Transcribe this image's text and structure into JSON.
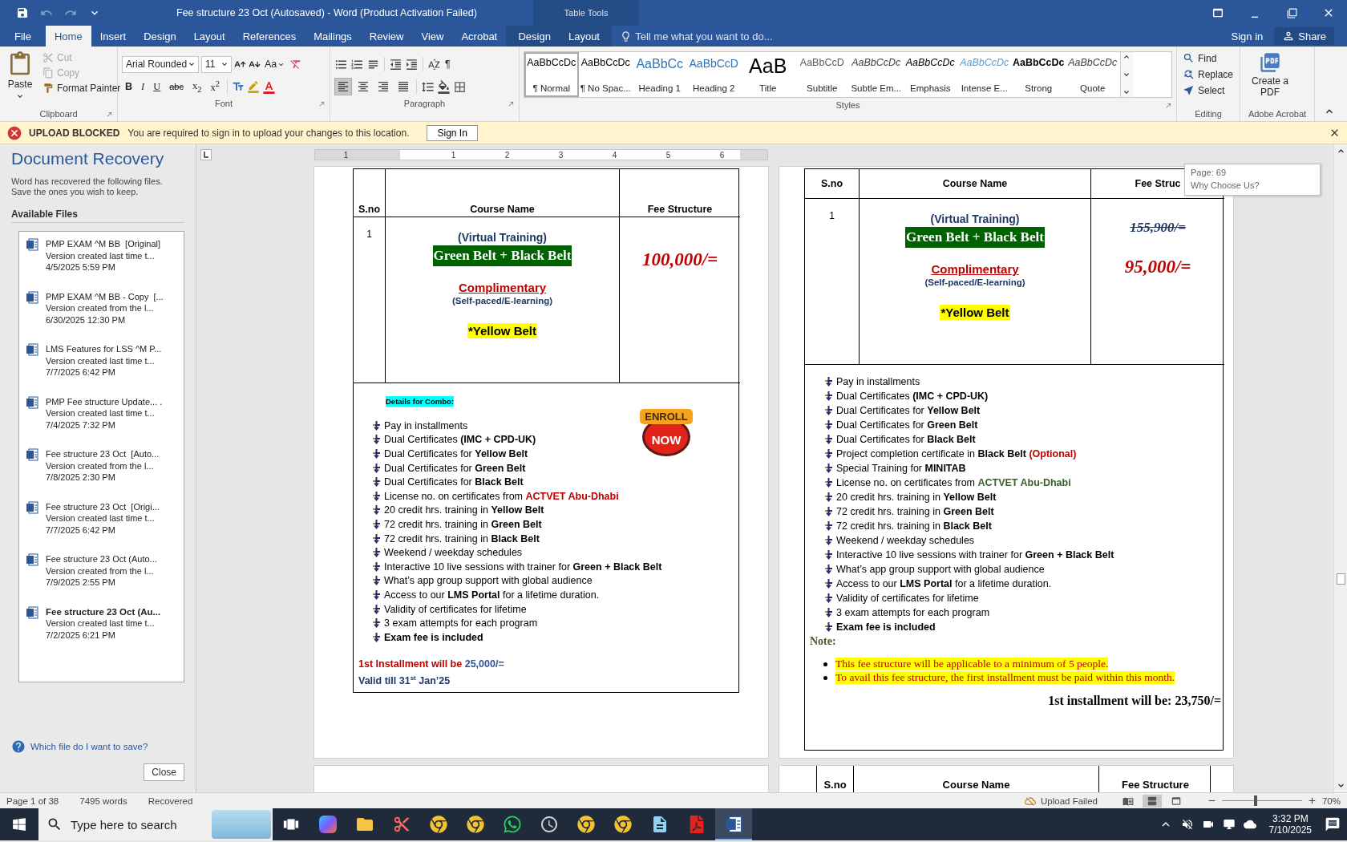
{
  "window": {
    "title": "Fee structure 23 Oct (Autosaved) - Word (Product Activation Failed)",
    "context_label": "Table Tools",
    "quick_access": [
      {
        "kind": "save",
        "disabled": false
      },
      {
        "kind": "undo",
        "disabled": true
      },
      {
        "kind": "redo",
        "disabled": true
      },
      {
        "kind": "customize",
        "disabled": false
      }
    ]
  },
  "menu": {
    "tabs": [
      {
        "label": "File",
        "kind": "file",
        "selected": false
      },
      {
        "label": "Home",
        "kind": "tab",
        "selected": true
      },
      {
        "label": "Insert",
        "kind": "tab",
        "selected": false
      },
      {
        "label": "Design",
        "kind": "tab",
        "selected": false
      },
      {
        "label": "Layout",
        "kind": "tab",
        "selected": false
      },
      {
        "label": "References",
        "kind": "tab",
        "selected": false
      },
      {
        "label": "Mailings",
        "kind": "tab",
        "selected": false
      },
      {
        "label": "Review",
        "kind": "tab",
        "selected": false
      },
      {
        "label": "View",
        "kind": "tab",
        "selected": false
      },
      {
        "label": "Acrobat",
        "kind": "tab",
        "selected": false
      },
      {
        "label": "Design",
        "kind": "context",
        "selected": false
      },
      {
        "label": "Layout",
        "kind": "context",
        "selected": false
      }
    ],
    "tell_me": "Tell me what you want to do...",
    "sign_in": "Sign in",
    "share": "Share"
  },
  "ribbon": {
    "clipboard": {
      "label": "Clipboard",
      "paste": "Paste",
      "items": [
        {
          "label": "Cut",
          "kind": "cut",
          "disabled": true
        },
        {
          "label": "Copy",
          "kind": "copy",
          "disabled": true
        },
        {
          "label": "Format Painter",
          "kind": "painter",
          "disabled": false
        }
      ]
    },
    "font": {
      "label": "Font",
      "name": "Arial Rounded",
      "size": "11",
      "case_button": "Aa",
      "format_buttons": [
        {
          "label": "B",
          "kind": "bold"
        },
        {
          "label": "I",
          "kind": "italic"
        },
        {
          "label": "U",
          "kind": "underline"
        },
        {
          "label": "abc",
          "kind": "strike"
        },
        {
          "label": "x$_{2}$",
          "kind": "sub"
        },
        {
          "label": "x$^{2}$",
          "kind": "sup"
        }
      ]
    },
    "paragraph": {
      "label": "Paragraph",
      "pilcrow": "¶",
      "align_buttons": [
        {
          "kind": "left",
          "selected": true
        },
        {
          "kind": "center",
          "selected": false
        },
        {
          "kind": "right",
          "selected": false
        },
        {
          "kind": "justify",
          "selected": false
        }
      ]
    },
    "styles": {
      "label": "Styles",
      "items": [
        {
          "preview": "AaBbCcDc",
          "name": "¶ Normal",
          "kind": "normal",
          "selected": true
        },
        {
          "preview": "AaBbCcDc",
          "name": "¶ No Spac...",
          "kind": "normal",
          "selected": false
        },
        {
          "preview": "AaBbCc",
          "name": "Heading 1",
          "kind": "heading1",
          "selected": false
        },
        {
          "preview": "AaBbCcD",
          "name": "Heading 2",
          "kind": "heading2",
          "selected": false
        },
        {
          "preview": "AaB",
          "name": "Title",
          "kind": "title",
          "selected": false
        },
        {
          "preview": "AaBbCcD",
          "name": "Subtitle",
          "kind": "subtitle",
          "selected": false
        },
        {
          "preview": "AaBbCcDc",
          "name": "Subtle Em...",
          "kind": "subtle",
          "selected": false
        },
        {
          "preview": "AaBbCcDc",
          "name": "Emphasis",
          "kind": "emphasis",
          "selected": false
        },
        {
          "preview": "AaBbCcDc",
          "name": "Intense E...",
          "kind": "intense",
          "selected": false
        },
        {
          "preview": "AaBbCcDc",
          "name": "Strong",
          "kind": "strong",
          "selected": false
        },
        {
          "preview": "AaBbCcDc",
          "name": "Quote",
          "kind": "quote",
          "selected": false
        }
      ]
    },
    "editing": {
      "label": "Editing",
      "items": [
        {
          "label": "Find",
          "kind": "find"
        },
        {
          "label": "Replace",
          "kind": "replace"
        },
        {
          "label": "Select",
          "kind": "select"
        }
      ]
    },
    "acrobat": {
      "label": "Adobe Acrobat",
      "button": "Create a PDF"
    }
  },
  "message_bar": {
    "title": "UPLOAD BLOCKED",
    "text": "You are required to sign in to upload your changes to this location.",
    "button": "Sign In"
  },
  "recovery": {
    "title": "Document Recovery",
    "description": "Word has recovered the following files. Save the ones you wish to keep.",
    "list_label": "Available Files",
    "files": [
      {
        "name": "PMP EXAM ^M BB  [Original]",
        "note": "Version created last time t...",
        "date": "4/5/2025 5:59 PM",
        "selected": false
      },
      {
        "name": "PMP EXAM ^M BB - Copy  [...",
        "note": "Version created from the l...",
        "date": "6/30/2025 12:30 PM",
        "selected": false
      },
      {
        "name": "LMS Features for LSS ^M P...",
        "note": "Version created last time t...",
        "date": "7/7/2025 6:42 PM",
        "selected": false
      },
      {
        "name": "PMP Fee structure Update... .",
        "note": "Version created last time t...",
        "date": "7/4/2025 7:32 PM",
        "selected": false
      },
      {
        "name": "Fee structure 23 Oct  [Auto...",
        "note": "Version created from the l...",
        "date": "7/8/2025 2:30 PM",
        "selected": false
      },
      {
        "name": "Fee structure 23 Oct  [Origi...",
        "note": "Version created last time t...",
        "date": "7/7/2025 6:42 PM",
        "selected": false
      },
      {
        "name": "Fee structure 23 Oct (Auto...",
        "note": "Version created from the l...",
        "date": "7/9/2025 2:55 PM",
        "selected": false
      },
      {
        "name": "Fee structure 23 Oct (Au...",
        "note": "Version created last time t...",
        "date": "7/2/2025 6:21 PM",
        "selected": true
      }
    ],
    "help": "Which file do I want to save?",
    "close": "Close"
  },
  "ruler": {
    "numbers": [
      "1",
      "1",
      "2",
      "3",
      "4",
      "5",
      "6"
    ]
  },
  "tooltip": {
    "page": "Page: 69",
    "heading": "Why Choose Us?"
  },
  "pages": [
    {
      "columns": [
        "S.no",
        "Course Name",
        "Fee Structure"
      ],
      "sno": "1",
      "course_lines": [
        {
          "text": "(Virtual Training)",
          "kind": "mode"
        },
        {
          "text": "Green Belt + Black Belt",
          "kind": "program"
        },
        {
          "text": "Complimentary",
          "kind": "offer"
        },
        {
          "text": "(Self-paced/E-learning)",
          "kind": "format"
        },
        {
          "text": "*Yellow Belt",
          "kind": "bonus"
        }
      ],
      "fees": [
        {
          "text": "100,000/=",
          "struck": false
        }
      ],
      "details_label": "Details for Combo:",
      "enroll": {
        "top": "ENROLL",
        "bottom": "NOW"
      },
      "bullets": [
        [
          {
            "text": "Pay in installments",
            "kind": "plain"
          }
        ],
        [
          {
            "text": "Dual Certificates ",
            "kind": "plain"
          },
          {
            "text": "(IMC + CPD-UK)",
            "kind": "bold"
          }
        ],
        [
          {
            "text": "Dual Certificates for ",
            "kind": "plain"
          },
          {
            "text": "Yellow Belt",
            "kind": "bold"
          }
        ],
        [
          {
            "text": "Dual Certificates for ",
            "kind": "plain"
          },
          {
            "text": "Green Belt",
            "kind": "bold"
          }
        ],
        [
          {
            "text": "Dual Certificates for ",
            "kind": "plain"
          },
          {
            "text": "Black Belt",
            "kind": "bold"
          }
        ],
        [
          {
            "text": "License no. on certificates from ",
            "kind": "plain"
          },
          {
            "text": "ACTVET Abu-Dhabi",
            "kind": "red"
          }
        ],
        [
          {
            "text": "20 credit hrs. training in ",
            "kind": "plain"
          },
          {
            "text": "Yellow Belt",
            "kind": "bold"
          }
        ],
        [
          {
            "text": "72 credit hrs. training in ",
            "kind": "plain"
          },
          {
            "text": "Green Belt",
            "kind": "bold"
          }
        ],
        [
          {
            "text": "72 credit hrs. training in ",
            "kind": "plain"
          },
          {
            "text": "Black Belt",
            "kind": "bold"
          }
        ],
        [
          {
            "text": "Weekend / weekday schedules",
            "kind": "plain"
          }
        ],
        [
          {
            "text": "Interactive 10 live sessions with trainer for ",
            "kind": "plain"
          },
          {
            "text": "Green + Black Belt",
            "kind": "bold"
          }
        ],
        [
          {
            "text": "What’s app group support with global audience",
            "kind": "plain"
          }
        ],
        [
          {
            "text": "Access to our ",
            "kind": "plain"
          },
          {
            "text": "LMS Portal",
            "kind": "bold"
          },
          {
            "text": " for a lifetime duration.",
            "kind": "plain"
          }
        ],
        [
          {
            "text": "Validity of certificates for lifetime",
            "kind": "plain"
          }
        ],
        [
          {
            "text": "3 exam attempts for each program",
            "kind": "plain"
          }
        ],
        [
          {
            "text": "Exam fee is included",
            "kind": "bold"
          }
        ]
      ],
      "footer": [
        [
          {
            "text": "1st Installment will be ",
            "kind": "red"
          },
          {
            "text": "25,000/=",
            "kind": "blue"
          }
        ],
        [
          {
            "text": "Valid till 31$^{st}$ Jan’25",
            "kind": "navy"
          }
        ]
      ]
    },
    {
      "columns": [
        "S.no",
        "Course Name",
        "Fee Struc"
      ],
      "sno": "1",
      "course_lines": [
        {
          "text": "(Virtual Training)",
          "kind": "mode"
        },
        {
          "text": "Green Belt + Black Belt",
          "kind": "program"
        },
        {
          "text": "Complimentary",
          "kind": "offer"
        },
        {
          "text": "(Self-paced/E-learning)",
          "kind": "format"
        },
        {
          "text": "*Yellow Belt",
          "kind": "bonus"
        }
      ],
      "fees": [
        {
          "text": "155,900/=",
          "struck": true
        },
        {
          "text": "95,000/=",
          "struck": false
        }
      ],
      "bullets": [
        [
          {
            "text": "Pay in installments",
            "kind": "plain"
          }
        ],
        [
          {
            "text": "Dual Certificates ",
            "kind": "plain"
          },
          {
            "text": "(IMC + CPD-UK)",
            "kind": "bold"
          }
        ],
        [
          {
            "text": "Dual Certificates for ",
            "kind": "plain"
          },
          {
            "text": "Yellow Belt",
            "kind": "bold"
          }
        ],
        [
          {
            "text": "Dual Certificates for ",
            "kind": "plain"
          },
          {
            "text": "Green Belt",
            "kind": "bold"
          }
        ],
        [
          {
            "text": "Dual Certificates for ",
            "kind": "plain"
          },
          {
            "text": "Black Belt",
            "kind": "bold"
          }
        ],
        [
          {
            "text": "Project completion certificate in ",
            "kind": "plain"
          },
          {
            "text": "Black Belt",
            "kind": "bold"
          },
          {
            "text": " (Optional)",
            "kind": "red"
          }
        ],
        [
          {
            "text": "Special Training for ",
            "kind": "plain"
          },
          {
            "text": "MINITAB",
            "kind": "bold"
          }
        ],
        [
          {
            "text": "License no. on certificates from ",
            "kind": "plain"
          },
          {
            "text": "ACTVET Abu-Dhabi",
            "kind": "green"
          }
        ],
        [
          {
            "text": "20 credit hrs. training in ",
            "kind": "plain"
          },
          {
            "text": "Yellow Belt",
            "kind": "bold"
          }
        ],
        [
          {
            "text": "72 credit hrs. training in ",
            "kind": "plain"
          },
          {
            "text": "Green Belt",
            "kind": "bold"
          }
        ],
        [
          {
            "text": "72 credit hrs. training in ",
            "kind": "plain"
          },
          {
            "text": "Black Belt",
            "kind": "bold"
          }
        ],
        [
          {
            "text": "Weekend / weekday schedules",
            "kind": "plain"
          }
        ],
        [
          {
            "text": "Interactive 10 live sessions with trainer for ",
            "kind": "plain"
          },
          {
            "text": "Green + Black Belt",
            "kind": "bold"
          }
        ],
        [
          {
            "text": "What’s app group support with global audience",
            "kind": "plain"
          }
        ],
        [
          {
            "text": "Access to our ",
            "kind": "plain"
          },
          {
            "text": "LMS Portal",
            "kind": "bold"
          },
          {
            "text": " for a lifetime duration.",
            "kind": "plain"
          }
        ],
        [
          {
            "text": "Validity of certificates for lifetime",
            "kind": "plain"
          }
        ],
        [
          {
            "text": "3 exam attempts for each program",
            "kind": "plain"
          }
        ],
        [
          {
            "text": "Exam fee is included",
            "kind": "bold"
          }
        ]
      ],
      "note": {
        "title": "Note:",
        "items": [
          "This fee structure will be applicable to a minimum of 5 people.",
          "To avail this fee structure, the first installment must be paid within this month."
        ],
        "closing": "1st installment will be: 23,750/="
      }
    }
  ],
  "next_page": {
    "columns": [
      "S.no",
      "Course Name",
      "Fee Structure"
    ]
  },
  "status_bar": {
    "page": "Page 1 of 38",
    "words": "7495 words",
    "state": "Recovered",
    "upload": "Upload Failed",
    "views": [
      {
        "kind": "read",
        "selected": false
      },
      {
        "kind": "print",
        "selected": true
      },
      {
        "kind": "web",
        "selected": false
      }
    ],
    "zoom": {
      "level": 0.42,
      "label": "70%"
    }
  },
  "taskbar": {
    "search": {
      "placeholder": "Type here to search"
    },
    "apps": [
      {
        "kind": "task-view",
        "selected": false
      },
      {
        "kind": "copilot",
        "selected": false
      },
      {
        "kind": "folder",
        "selected": false
      },
      {
        "kind": "snip",
        "selected": false
      },
      {
        "kind": "chrome",
        "selected": false
      },
      {
        "kind": "chrome",
        "selected": false
      },
      {
        "kind": "whatsapp",
        "selected": false
      },
      {
        "kind": "clock",
        "selected": false
      },
      {
        "kind": "chrome",
        "selected": false
      },
      {
        "kind": "chrome",
        "selected": false
      },
      {
        "kind": "notepad",
        "selected": false
      },
      {
        "kind": "acrobat",
        "selected": false
      },
      {
        "kind": "word",
        "selected": true
      }
    ],
    "time": "3:32 PM",
    "date": "7/10/2025"
  }
}
